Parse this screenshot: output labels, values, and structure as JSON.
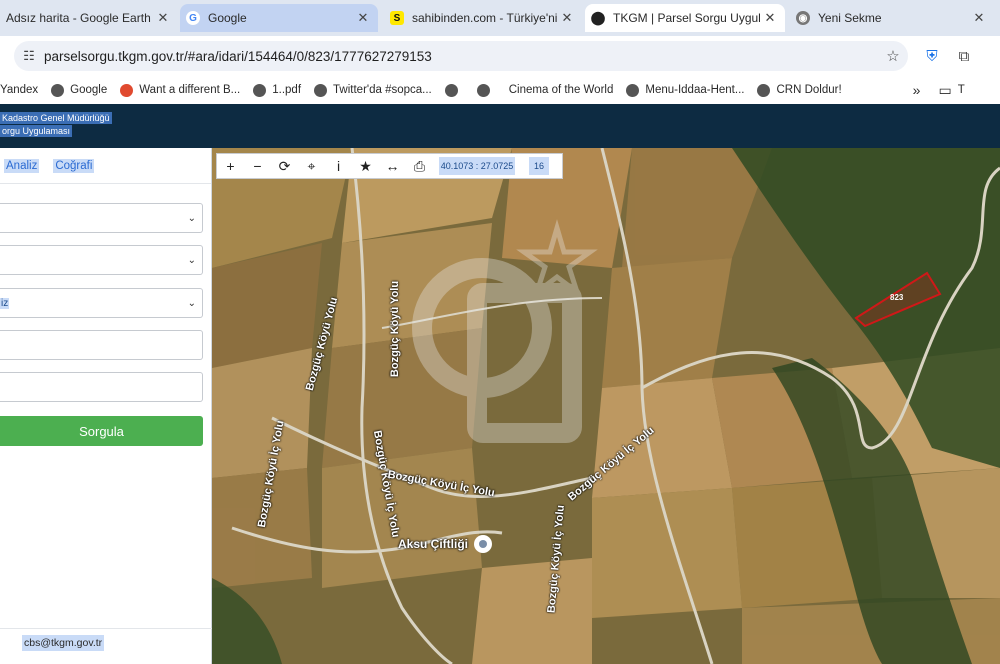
{
  "browser": {
    "tabs": [
      {
        "title": "Adsız harita - Google Earth",
        "icon": "google-earth-icon",
        "state": "normal"
      },
      {
        "title": "Google",
        "icon": "google-icon",
        "state": "highlighted"
      },
      {
        "title": "sahibinden.com - Türkiye'nin",
        "icon": "sahibinden-icon",
        "state": "normal"
      },
      {
        "title": "TKGM | Parsel Sorgu Uygular",
        "icon": "location-pin-icon",
        "state": "active"
      },
      {
        "title": "Yeni Sekme",
        "icon": "chrome-icon",
        "state": "normal"
      }
    ],
    "url": "parselsorgu.tkgm.gov.tr/#ara/idari/154464/0/823/1777627279153",
    "bookmarks": [
      "Yandex",
      "Google",
      "Want a different B...",
      "1..pdf",
      "Twitter'da #sopca...",
      "",
      "",
      "Cinema of the World",
      "Menu-Iddaa-Hent...",
      "CRN Doldur!"
    ],
    "bookmarks_overflow": "»",
    "bookmarks_folder": "T"
  },
  "app": {
    "header_line1": "Kadastro Genel Müdürlüğü",
    "header_line2": "orgu Uygulaması",
    "tabs": [
      "Analiz",
      "Coğrafi"
    ],
    "select_partial_value": "iz",
    "submit_label": "Sorgula",
    "footer_email": "cbs@tkgm.gov.tr"
  },
  "map": {
    "toolbar_icons": [
      "zoom-in-icon",
      "zoom-out-icon",
      "refresh-icon",
      "locate-icon",
      "info-icon",
      "star-icon",
      "measure-icon",
      "print-icon"
    ],
    "toolbar_glyphs": [
      "+",
      "−",
      "⟳",
      "⌖",
      "i",
      "★",
      "↔",
      "⎙"
    ],
    "coordinates": "40.1073 : 27.0725",
    "zoom_level": "16",
    "road_label": "Bozgüç Köyü İç Yolu",
    "road_label_short": "Bozgüç Köyü Yolu",
    "poi_label": "Aksu Çiftliği",
    "parcel_number": "823",
    "colors": {
      "parcel_outline": "#d01818",
      "header_bg": "#0d2b42",
      "submit_bg": "#4caf50"
    }
  }
}
